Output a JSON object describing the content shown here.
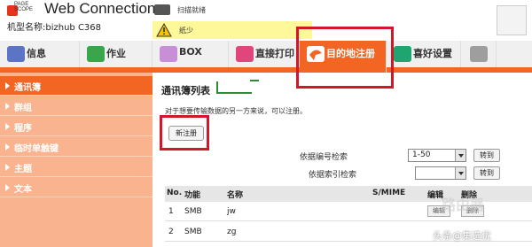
{
  "header": {
    "logo_small": "PAGE\nSCOPE",
    "logo_title": "Web Connection",
    "model_label": "机型名称:bizhub C368",
    "status_scan": "扫描就绪",
    "status_warning": "纸少"
  },
  "tabs": [
    {
      "label": "信息",
      "icon": "info-icon",
      "color": "#5b74c5"
    },
    {
      "label": "作业",
      "icon": "job-icon",
      "color": "#3aa54a"
    },
    {
      "label": "BOX",
      "icon": "box-icon",
      "color": "#c78fd6"
    },
    {
      "label": "直接打印",
      "icon": "print-icon",
      "color": "#e0457b"
    },
    {
      "label": "目的地注册",
      "icon": "destination-icon",
      "color": "#ffffff"
    },
    {
      "label": "喜好设置",
      "icon": "favorite-settings-icon",
      "color": "#1fa56f"
    }
  ],
  "sidebar": {
    "items": [
      {
        "label": "通讯簿"
      },
      {
        "label": "群组"
      },
      {
        "label": "程序"
      },
      {
        "label": "临时单触键"
      },
      {
        "label": "主题"
      },
      {
        "label": "文本"
      }
    ]
  },
  "main": {
    "title": "通讯簿列表",
    "description": "对于想要传输数据的另一方来说，可以注册。",
    "new_button": "新注册",
    "search_by_number_label": "依据编号检索",
    "search_by_number_value": "1-50",
    "search_by_index_label": "依据索引检索",
    "search_by_index_value": "",
    "go_label": "转到"
  },
  "table": {
    "headers": [
      "No.",
      "功能",
      "名称",
      "S/MIME",
      "编辑",
      "删除"
    ],
    "rows": [
      {
        "no": "1",
        "function": "SMB",
        "name": "jw",
        "edit": "编辑",
        "delete": "删除"
      },
      {
        "no": "2",
        "function": "SMB",
        "name": "zg",
        "edit": "",
        "delete": ""
      }
    ]
  },
  "watermark": "头条@集选优",
  "watermark_logo": "路由器"
}
